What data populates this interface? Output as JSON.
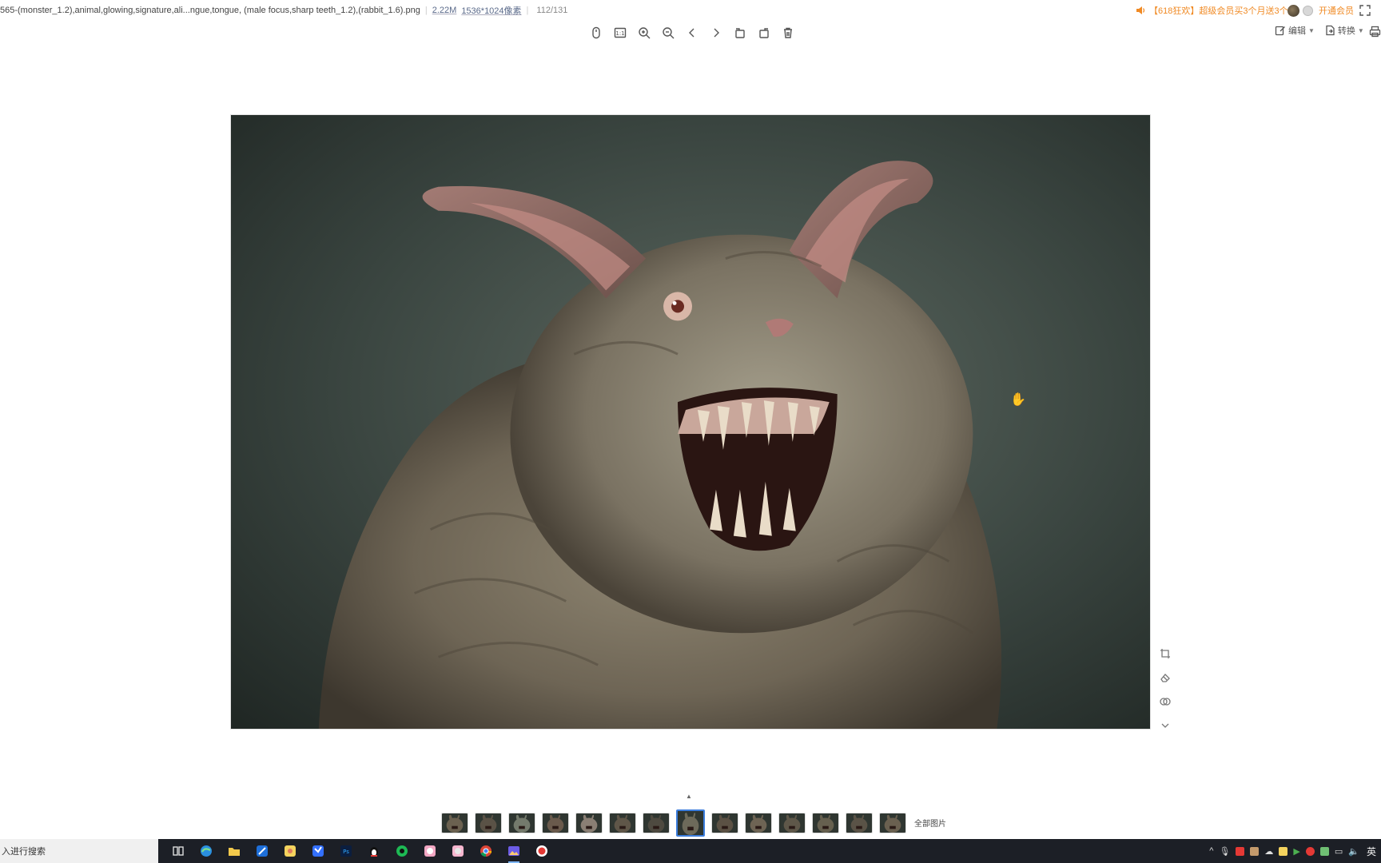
{
  "info": {
    "filename": "565-(monster_1.2),animal,glowing,signature,ali...ngue,tongue, (male focus,sharp teeth_1.2),(rabbit_1.6).png",
    "filesize": "2.22M",
    "dimensions": "1536*1024像素",
    "counter": "112/131"
  },
  "promo": {
    "text": "【618狂欢】超级会员买3个月送3个月",
    "vip_label": "开通会员"
  },
  "right_tools": {
    "edit_label": "编辑",
    "convert_label": "转换"
  },
  "filmstrip": {
    "all_images_label": "全部图片",
    "thumbnail_count": 14,
    "active_index": 7
  },
  "taskbar": {
    "search_text": "入进行搜索",
    "language": "英"
  },
  "colors": {
    "promo": "#f08a24",
    "active_thumb": "#3b7ddd",
    "taskbar_bg": "#1c1f26"
  }
}
